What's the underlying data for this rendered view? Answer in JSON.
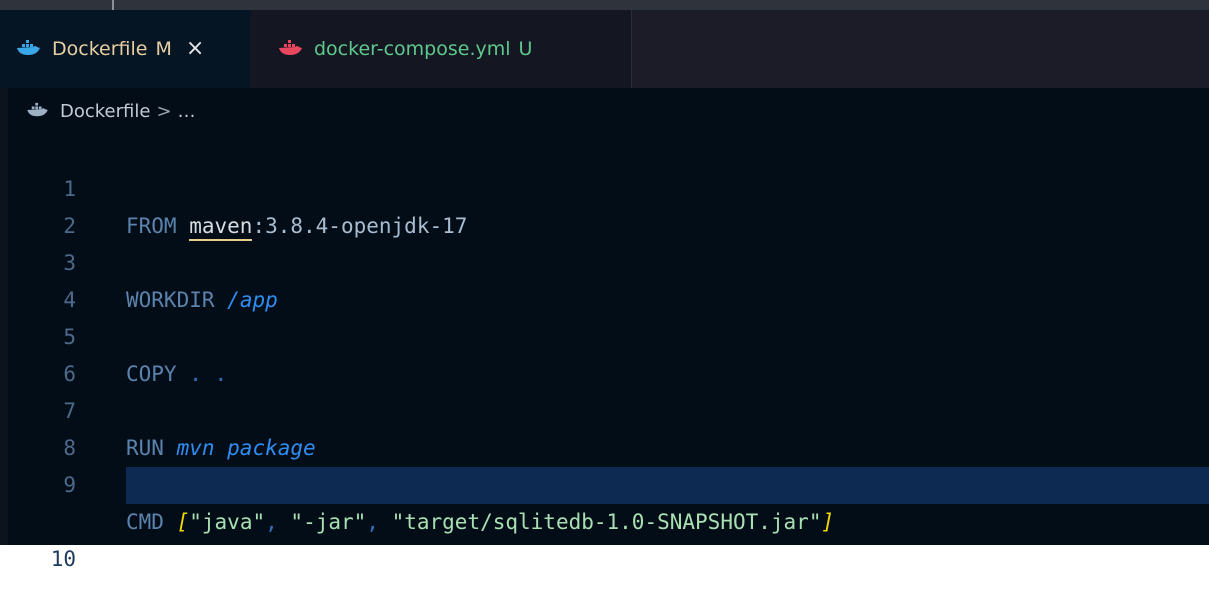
{
  "tabs": [
    {
      "label": "Dockerfile",
      "status": "M",
      "close_glyph": "×",
      "icon": "docker-whale-icon",
      "active": true
    },
    {
      "label": "docker-compose.yml",
      "status": "U",
      "icon": "docker-whale-icon",
      "active": false
    }
  ],
  "breadcrumb": {
    "file": "Dockerfile",
    "separator": ">",
    "rest": "…"
  },
  "editor": {
    "lines": [
      {
        "number": "1",
        "kw": "FROM",
        "ident": "maven",
        "rest": ":3.8.4-openjdk-17"
      },
      {
        "number": "2"
      },
      {
        "number": "3",
        "kw": "WORKDIR",
        "path": "/app"
      },
      {
        "number": "4"
      },
      {
        "number": "5",
        "kw": "COPY",
        "dots": ". ."
      },
      {
        "number": "6"
      },
      {
        "number": "7",
        "kw": "RUN",
        "cmd": "mvn package"
      },
      {
        "number": "8"
      },
      {
        "number": "9",
        "kw": "CMD",
        "open": "[",
        "s1": "\"java\"",
        "c1": ",",
        "s2": "\"-jar\"",
        "c2": ",",
        "s3": "\"target/sqlitedb-1.0-SNAPSHOT.jar\"",
        "close": "]"
      },
      {
        "number": "10"
      }
    ]
  },
  "colors": {
    "editor_bg": "#020d18",
    "active_tab_text": "#e7cfa2",
    "untracked_tab_text": "#5fc98d",
    "current_line_bg": "#0c2a52"
  }
}
